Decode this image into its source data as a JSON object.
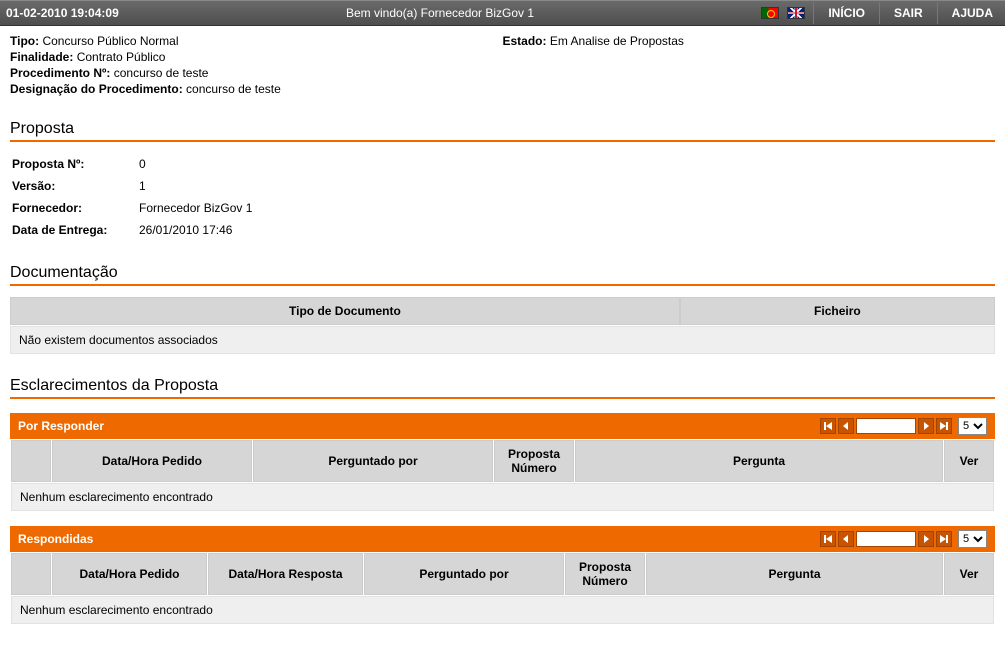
{
  "topbar": {
    "datetime": "01-02-2010 19:04:09",
    "welcome": "Bem vindo(a) Fornecedor BizGov 1",
    "nav": {
      "home": "INÍCIO",
      "exit": "SAIR",
      "help": "AJUDA"
    }
  },
  "info": {
    "tipo_label": "Tipo:",
    "tipo_value": "Concurso Público Normal",
    "estado_label": "Estado:",
    "estado_value": "Em Analise de Propostas",
    "finalidade_label": "Finalidade:",
    "finalidade_value": "Contrato Público",
    "procedimento_n_label": "Procedimento Nº:",
    "procedimento_n_value": "concurso de teste",
    "designacao_label": "Designação do Procedimento:",
    "designacao_value": "concurso de teste"
  },
  "sections": {
    "proposta": "Proposta",
    "documentacao": "Documentação",
    "esclarecimentos": "Esclarecimentos da Proposta"
  },
  "proposta": {
    "n_label": "Proposta Nº:",
    "n_value": "0",
    "versao_label": "Versão:",
    "versao_value": "1",
    "fornecedor_label": "Fornecedor:",
    "fornecedor_value": "Fornecedor BizGov 1",
    "data_entrega_label": "Data de Entrega:",
    "data_entrega_value": "26/01/2010 17:46"
  },
  "doc_table": {
    "col_tipo": "Tipo de Documento",
    "col_ficheiro": "Ficheiro",
    "empty": "Não existem documentos associados"
  },
  "band_pending": "Por Responder",
  "band_answered": "Respondidas",
  "pager": {
    "page_size": "5"
  },
  "grid_pending": {
    "col_checkbox": "",
    "col_data_pedido": "Data/Hora Pedido",
    "col_perguntado": "Perguntado por",
    "col_proposta_n": "Proposta Número",
    "col_pergunta": "Pergunta",
    "col_ver": "Ver",
    "empty": "Nenhum esclarecimento encontrado"
  },
  "grid_answered": {
    "col_checkbox": "",
    "col_data_pedido": "Data/Hora Pedido",
    "col_data_resposta": "Data/Hora Resposta",
    "col_perguntado": "Perguntado por",
    "col_proposta_n": "Proposta Número",
    "col_pergunta": "Pergunta",
    "col_ver": "Ver",
    "empty": "Nenhum esclarecimento encontrado"
  }
}
